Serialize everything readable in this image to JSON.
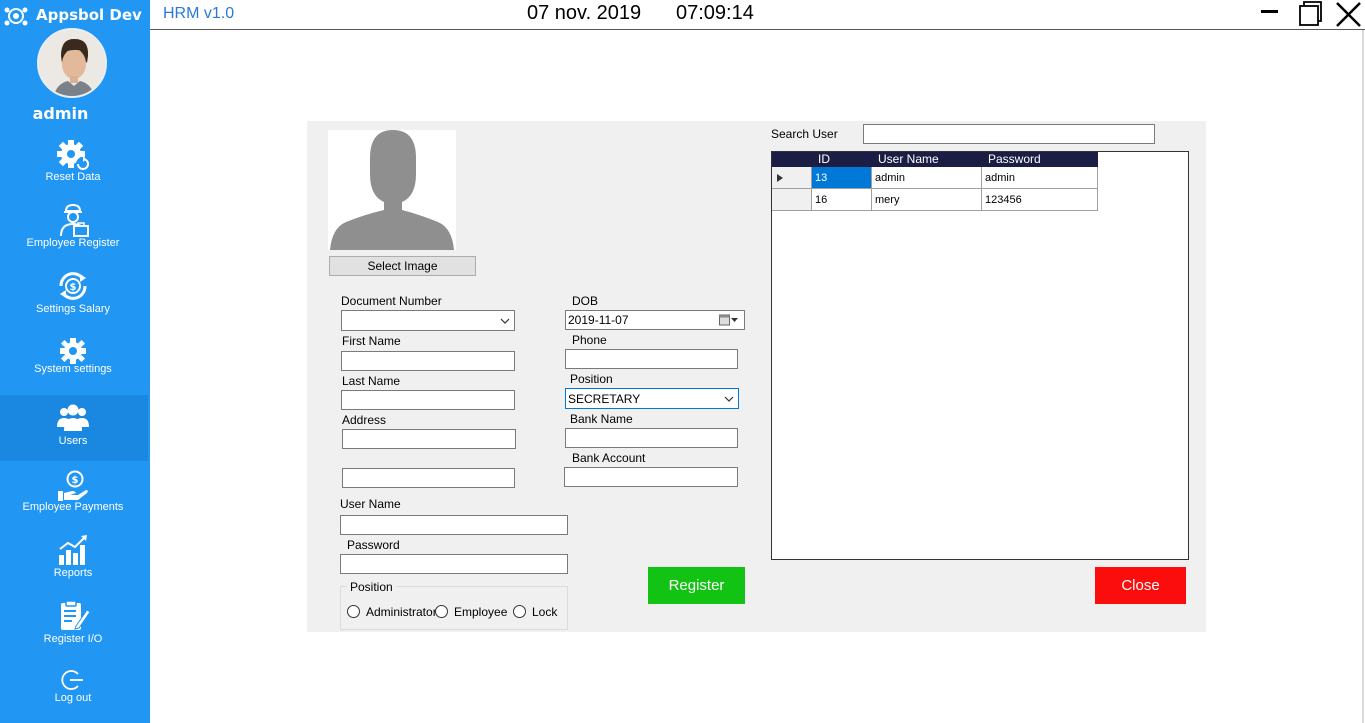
{
  "sidebar": {
    "brand": "Appsbol Dev",
    "user_label": "admin",
    "items": [
      {
        "label": "Reset Data",
        "icon": "gear-refresh-icon"
      },
      {
        "label": "Employee Register",
        "icon": "employee-icon"
      },
      {
        "label": "Settings Salary",
        "icon": "salary-refresh-icon"
      },
      {
        "label": "System settings",
        "icon": "gear-icon"
      },
      {
        "label": "Users",
        "icon": "users-icon"
      },
      {
        "label": "Employee Payments",
        "icon": "payment-hand-icon"
      },
      {
        "label": "Reports",
        "icon": "chart-icon"
      },
      {
        "label": "Register I/O",
        "icon": "clipboard-icon"
      },
      {
        "label": "Log out",
        "icon": "logout-icon"
      }
    ],
    "active": "Users"
  },
  "topbar": {
    "app_version": "HRM v1.0",
    "date": "07 nov. 2019",
    "time": "07:09:14"
  },
  "form": {
    "select_image_label": "Select Image",
    "document_number": {
      "label": "Document Number",
      "value": ""
    },
    "first_name": {
      "label": "First Name",
      "value": ""
    },
    "last_name": {
      "label": "Last Name",
      "value": ""
    },
    "address": {
      "label": "Address",
      "value": "",
      "value2": ""
    },
    "user_name": {
      "label": "User Name",
      "value": ""
    },
    "password": {
      "label": "Password",
      "value": ""
    },
    "dob": {
      "label": "DOB",
      "value": "2019-11-07"
    },
    "phone": {
      "label": "Phone",
      "value": ""
    },
    "position": {
      "label": "Position",
      "value": "SECRETARY"
    },
    "bank_name": {
      "label": "Bank Name",
      "value": ""
    },
    "bank_account": {
      "label": "Bank Account",
      "value": ""
    },
    "position_group": {
      "legend": "Position",
      "options": [
        "Administrator",
        "Employee",
        "Lock"
      ]
    },
    "register_label": "Register",
    "close_label": "Close"
  },
  "search": {
    "label": "Search User",
    "value": ""
  },
  "grid": {
    "columns": [
      "ID",
      "User Name",
      "Password"
    ],
    "rows": [
      {
        "id": "13",
        "user_name": "admin",
        "password": "admin"
      },
      {
        "id": "16",
        "user_name": "mery",
        "password": "123456"
      }
    ]
  },
  "colors": {
    "sidebar": "#2196f3",
    "register": "#13c313",
    "close": "#fc0d0d",
    "grid_header": "#1b1d44",
    "selection": "#0078d7"
  }
}
